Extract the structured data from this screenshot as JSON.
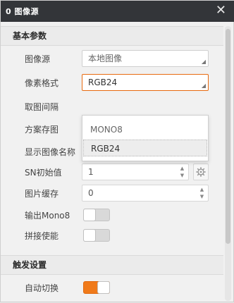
{
  "window": {
    "title": "0 图像源",
    "close_glyph": "✕"
  },
  "sections": {
    "basic": "基本参数",
    "trigger": "触发设置"
  },
  "fields": {
    "image_source": {
      "label": "图像源",
      "value": "本地图像"
    },
    "pixel_format": {
      "label": "像素格式",
      "value": "RGB24"
    },
    "capture_interval": {
      "label": "取图间隔"
    },
    "scheme_image": {
      "label": "方案存图"
    },
    "show_image_name": {
      "label": "显示图像名称"
    },
    "sn_initial": {
      "label": "SN初始值",
      "value": "1"
    },
    "image_cache": {
      "label": "图片缓存",
      "value": "0"
    },
    "output_mono8": {
      "label": "输出Mono8"
    },
    "stitch_enable": {
      "label": "拼接使能"
    },
    "auto_switch": {
      "label": "自动切换"
    }
  },
  "pixel_format_options": [
    "MONO8",
    "RGB24"
  ],
  "colors": {
    "accent": "#f07a1a",
    "titlebar": "#333539"
  },
  "icons": {
    "close": "close-icon",
    "gear": "gear-icon",
    "resize": "resize-grip-icon"
  }
}
